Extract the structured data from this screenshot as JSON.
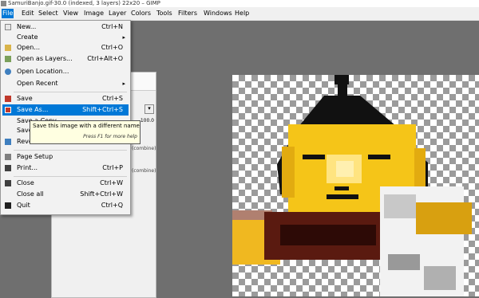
{
  "window": {
    "title": "SamuriBanjo.gif-30.0 (indexed, 3 layers) 22x20 – GIMP"
  },
  "menubar": [
    "File",
    "Edit",
    "Select",
    "View",
    "Image",
    "Layer",
    "Colors",
    "Tools",
    "Filters",
    "Windows",
    "Help"
  ],
  "file_menu": {
    "items": [
      {
        "label": "New...",
        "shortcut": "Ctrl+N",
        "icon": "new-icon",
        "color": "#e6e6e6"
      },
      {
        "label": "Create",
        "shortcut": "",
        "icon": "",
        "color": ""
      },
      {
        "label": "Open...",
        "shortcut": "Ctrl+O",
        "icon": "folder-open-icon",
        "color": "#d9b44a"
      },
      {
        "label": "Open as Layers...",
        "shortcut": "Ctrl+Alt+O",
        "icon": "layers-icon",
        "color": "#7ba05b"
      },
      {
        "label": "Open Location...",
        "shortcut": "",
        "icon": "globe-icon",
        "color": "#3f7fbf"
      },
      {
        "label": "Open Recent",
        "shortcut": "",
        "icon": "",
        "color": ""
      },
      {
        "label": "Save",
        "shortcut": "Ctrl+S",
        "icon": "save-icon",
        "color": "#c0392b"
      },
      {
        "label": "Save As...",
        "shortcut": "Shift+Ctrl+S",
        "icon": "save-as-icon",
        "color": "#c0392b"
      },
      {
        "label": "Save a Copy...",
        "shortcut": "",
        "icon": "",
        "color": ""
      },
      {
        "label": "Save",
        "shortcut": "",
        "icon": "",
        "color": ""
      },
      {
        "label": "Revert",
        "shortcut": "",
        "icon": "revert-icon",
        "color": "#3f7fbf"
      },
      {
        "label": "Page Setup",
        "shortcut": "",
        "icon": "page-setup-icon",
        "color": "#808080"
      },
      {
        "label": "Print...",
        "shortcut": "Ctrl+P",
        "icon": "print-icon",
        "color": "#404040"
      },
      {
        "label": "Close",
        "shortcut": "Ctrl+W",
        "icon": "close-icon",
        "color": "#404040"
      },
      {
        "label": "Close all",
        "shortcut": "Shift+Ctrl+W",
        "icon": "close-all-icon",
        "color": "#404040"
      },
      {
        "label": "Quit",
        "shortcut": "Ctrl+Q",
        "icon": "quit-icon",
        "color": "#202020"
      }
    ],
    "highlighted_index": 7
  },
  "tooltip": {
    "text": "Save this image with a different name",
    "hint": "Press F1 for more help"
  },
  "dock": {
    "value": "100.0",
    "layer1": "(combine)",
    "layer2": "(combine)"
  },
  "colors": {
    "accent": "#0078d7",
    "face": "#f5c518",
    "hair": "#111111"
  }
}
